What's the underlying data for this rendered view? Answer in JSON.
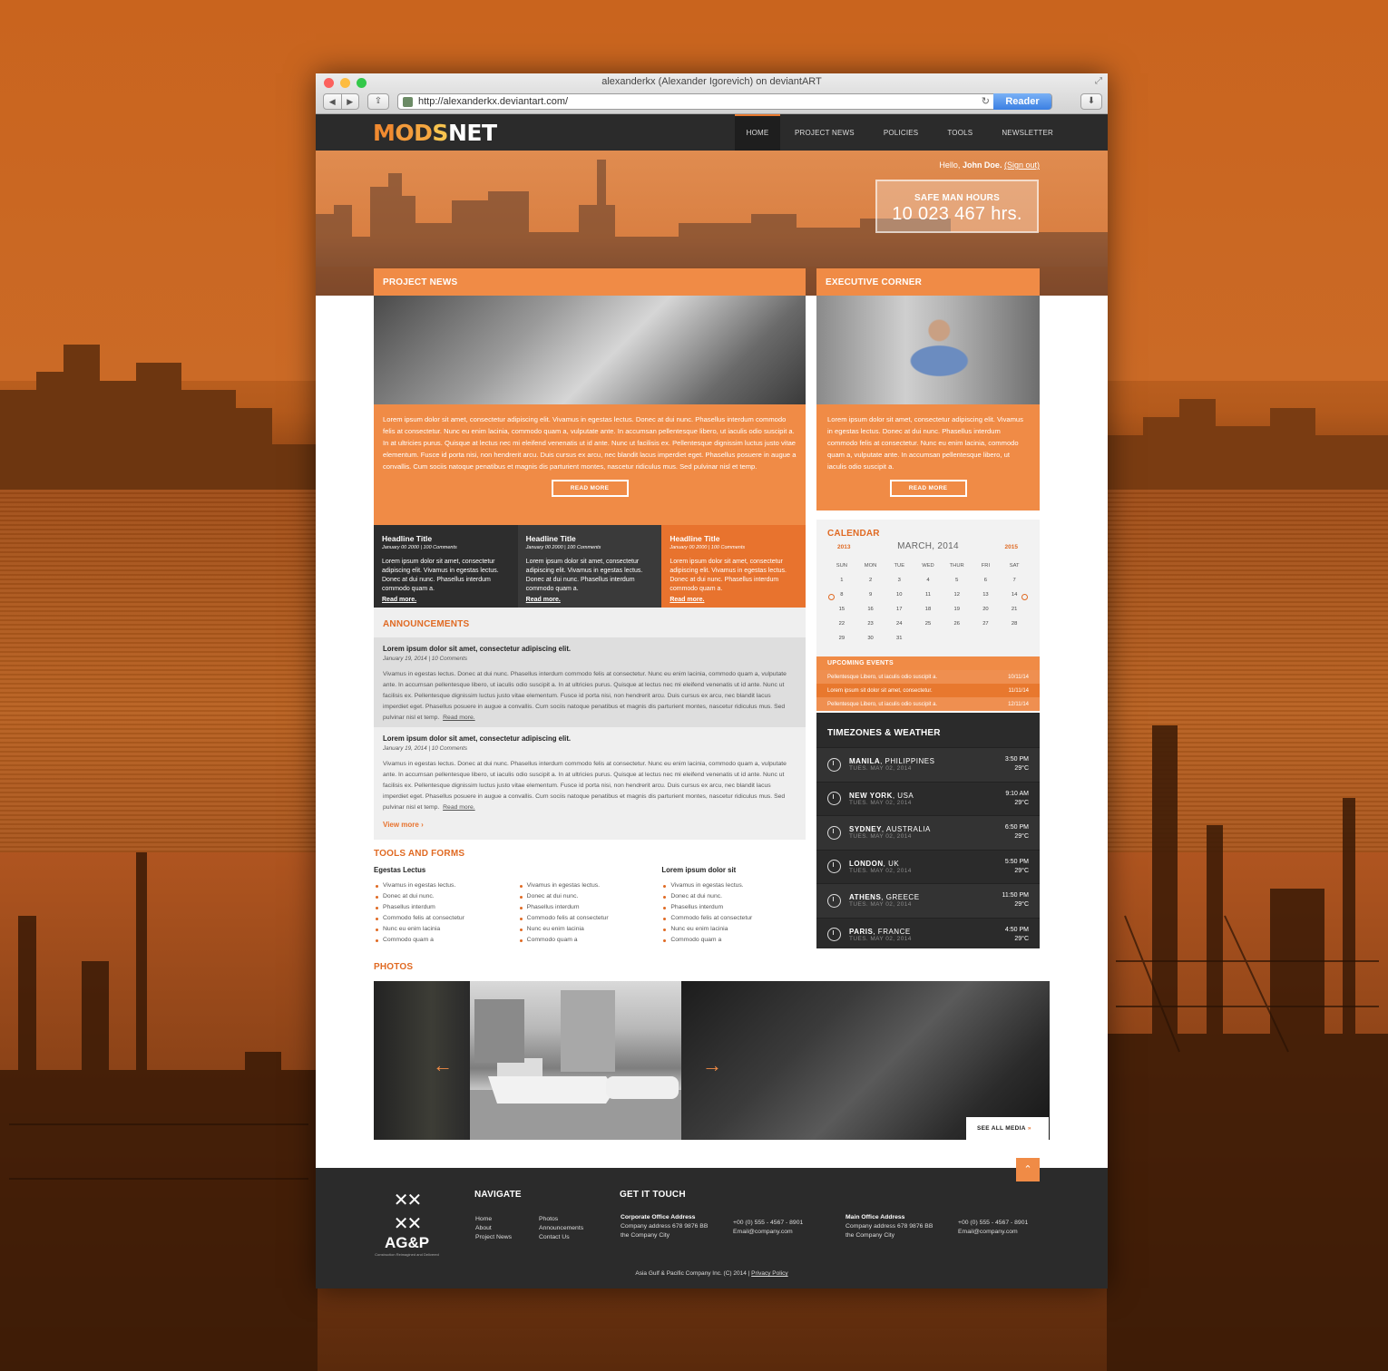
{
  "browser": {
    "title": "alexanderkx (Alexander Igorevich) on deviantART",
    "url": "http://alexanderkx.deviantart.com/",
    "reader": "Reader"
  },
  "site": {
    "logo": {
      "m": "M",
      "o": "O",
      "d": "D",
      "s": "S",
      "net": "NET"
    },
    "nav": [
      "HOME",
      "PROJECT NEWS",
      "POLICIES",
      "TOOLS",
      "NEWSLETTER"
    ],
    "hello": {
      "prefix": "Hello,",
      "name": "John Doe.",
      "signout": "(Sign out)"
    },
    "safe": {
      "label": "SAFE MAN HOURS",
      "value": "10 023 467 hrs."
    },
    "project_news": {
      "title": "PROJECT NEWS",
      "body": "Lorem ipsum dolor sit amet, consectetur adipiscing elit. Vivamus in egestas lectus. Donec at dui nunc. Phasellus interdum commodo felis at consectetur. Nunc eu enim lacinia, commodo quam a, vulputate ante. In accumsan pellentesque libero, ut iaculis odio suscipit a. In at ultricies purus. Quisque at lectus nec mi eleifend venenatis ut id ante. Nunc ut facilisis ex. Pellentesque dignissim luctus justo vitae elementum. Fusce id porta nisi, non hendrerit arcu. Duis cursus ex arcu, nec blandit lacus imperdiet eget. Phasellus posuere in augue a convallis. Cum sociis natoque penatibus et magnis dis parturient montes, nascetur ridiculus mus. Sed pulvinar nisl et temp.",
      "button": "READ MORE"
    },
    "headlines": [
      {
        "title": "Headline Title",
        "meta": "January 00 2000  |  100 Comments",
        "body": "Lorem ipsum dolor sit amet, consectetur adipiscing elit. Vivamus in egestas lectus. Donec at dui nunc. Phasellus interdum commodo quam a.",
        "link": "Read more.",
        "color": "#2d2d2d"
      },
      {
        "title": "Headline Title",
        "meta": "January 00 2000  |  100 Comments",
        "body": "Lorem ipsum dolor sit amet, consectetur adipiscing elit. Vivamus in egestas lectus. Donec at dui nunc. Phasellus interdum commodo quam a.",
        "link": "Read more.",
        "color": "#3a3a3a"
      },
      {
        "title": "Headline Title",
        "meta": "January 00 2000  |  100 Comments",
        "body": "Lorem ipsum dolor sit amet, consectetur adipiscing elit. Vivamus in egestas lectus. Donec at dui nunc. Phasellus interdum commodo quam a.",
        "link": "Read more.",
        "color": "#e8732e"
      }
    ],
    "announcements": {
      "title": "ANNOUNCEMENTS",
      "items": [
        {
          "title": "Lorem ipsum dolor sit amet, consectetur adipiscing elit.",
          "meta": "January 19, 2014   |   10 Comments",
          "body": "Vivamus in egestas lectus. Donec at dui nunc. Phasellus interdum commodo felis at consectetur. Nunc eu enim lacinia, commodo quam a, vulputate ante. In accumsan pellentesque libero, ut iaculis odio suscipit a. In at ultricies purus. Quisque at lectus nec mi eleifend venenatis ut id ante. Nunc ut facilisis ex. Pellentesque dignissim luctus justo vitae elementum. Fusce id porta nisi, non hendrerit arcu. Duis cursus ex arcu, nec blandit lacus imperdiet eget. Phasellus posuere in augue a convallis. Cum sociis natoque penatibus et magnis dis parturient montes, nascetur ridiculus mus. Sed pulvinar nisl et temp.",
          "link": "Read more."
        },
        {
          "title": "Lorem ipsum dolor sit amet, consectetur adipiscing elit.",
          "meta": "January 19, 2014   |   10 Comments",
          "body": "Vivamus in egestas lectus. Donec at dui nunc. Phasellus interdum commodo felis at consectetur. Nunc eu enim lacinia, commodo quam a, vulputate ante. In accumsan pellentesque libero, ut iaculis odio suscipit a. In at ultricies purus. Quisque at lectus nec mi eleifend venenatis ut id ante. Nunc ut facilisis ex. Pellentesque dignissim luctus justo vitae elementum. Fusce id porta nisi, non hendrerit arcu. Duis cursus ex arcu, nec blandit lacus imperdiet eget. Phasellus posuere in augue a convallis. Cum sociis natoque penatibus et magnis dis parturient montes, nascetur ridiculus mus. Sed pulvinar nisl et temp.",
          "link": "Read more."
        }
      ],
      "view_more": "View more"
    },
    "tools": {
      "title": "TOOLS AND FORMS",
      "columns": [
        {
          "heading": "Egestas Lectus",
          "items": [
            "Vivamus in egestas lectus.",
            "Donec at dui nunc.",
            "Phasellus interdum",
            "Commodo felis at consectetur",
            "Nunc eu enim lacinia",
            "Commodo quam a"
          ]
        },
        {
          "heading": "",
          "items": [
            "Vivamus in egestas lectus.",
            "Donec at dui nunc.",
            "Phasellus interdum",
            "Commodo felis at consectetur",
            "Nunc eu enim lacinia",
            "Commodo quam a"
          ]
        },
        {
          "heading": "Lorem ipsum dolor sit",
          "items": [
            "Vivamus in egestas lectus.",
            "Donec at dui nunc.",
            "Phasellus interdum",
            "Commodo felis at consectetur",
            "Nunc eu enim lacinia",
            "Commodo quam a"
          ]
        }
      ]
    },
    "executive": {
      "title": "EXECUTIVE CORNER",
      "body": "Lorem ipsum dolor sit amet, consectetur adipiscing elit. Vivamus in egestas lectus. Donec at dui nunc. Phasellus interdum commodo felis at consectetur. Nunc eu enim lacinia, commodo quam a, vulputate ante. In accumsan pellentesque libero, ut iaculis odio suscipit a.",
      "button": "READ MORE"
    },
    "calendar": {
      "title": "CALENDAR",
      "prev_year": "2013",
      "month": "MARCH, 2014",
      "next_year": "2015",
      "days": [
        "SUN",
        "MON",
        "TUE",
        "WED",
        "THUR",
        "FRI",
        "SAT"
      ],
      "dates": [
        "1",
        "2",
        "3",
        "4",
        "5",
        "6",
        "7",
        "8",
        "9",
        "10",
        "11",
        "12",
        "13",
        "14",
        "15",
        "16",
        "17",
        "18",
        "19",
        "20",
        "21",
        "22",
        "23",
        "24",
        "25",
        "26",
        "27",
        "28",
        "29",
        "30",
        "31"
      ]
    },
    "events": {
      "title": "UPCOMING EVENTS",
      "items": [
        {
          "text": "Pellentesque Libero, ut iaculis odio suscipit a.",
          "date": "10/11/14"
        },
        {
          "text": "Lorem ipsum sit dolor sit amet, consectetur.",
          "date": "11/11/14"
        },
        {
          "text": "Pellentesque Libero, ut iaculis odio suscipit a.",
          "date": "12/11/14"
        }
      ]
    },
    "timezones": {
      "title": "TIMEZONES & WEATHER",
      "items": [
        {
          "city": "MANILA",
          "country": ", PHILIPPINES",
          "date": "TUES. MAY 02, 2014",
          "time": "3:50 PM",
          "temp": "29°C"
        },
        {
          "city": "NEW YORK",
          "country": ", USA",
          "date": "TUES. MAY 02, 2014",
          "time": "9:10 AM",
          "temp": "29°C"
        },
        {
          "city": "SYDNEY",
          "country": ", AUSTRALIA",
          "date": "TUES. MAY 02, 2014",
          "time": "6:50 PM",
          "temp": "29°C"
        },
        {
          "city": "LONDON",
          "country": ", UK",
          "date": "TUES. MAY 02, 2014",
          "time": "5:50 PM",
          "temp": "29°C"
        },
        {
          "city": "ATHENS",
          "country": ", GREECE",
          "date": "TUES. MAY 02, 2014",
          "time": "11:50 PM",
          "temp": "29°C"
        },
        {
          "city": "PARIS",
          "country": ", FRANCE",
          "date": "TUES. MAY 02, 2014",
          "time": "4:50 PM",
          "temp": "29°C"
        }
      ]
    },
    "photos": {
      "title": "PHOTOS",
      "see_all": "SEE ALL MEDIA"
    },
    "footer": {
      "brand": "AG&P",
      "tagline": "Construction Reimagined and Delivered",
      "navigate": {
        "title": "NAVIGATE",
        "col1": [
          "Home",
          "About",
          "Project News"
        ],
        "col2": [
          "Photos",
          "Announcements",
          "Contact Us"
        ]
      },
      "contact": {
        "title": "GET IT TOUCH",
        "corp": {
          "heading": "Corporate Office Address",
          "l1": "Company address 678 9876 BB",
          "l2": "the Company City",
          "phone": "+00 (0) 555 - 4567 - 8901",
          "email": "Email@company.com"
        },
        "main": {
          "heading": "Main Office Address",
          "l1": "Company address 678 9876 BB",
          "l2": "the Company City",
          "phone": "+00 (0) 555 - 4567 - 8901",
          "email": "Email@company.com"
        }
      },
      "copyright": "Asia Gulf & Pacific Company Inc. (C) 2014 |",
      "privacy": "Privacy Policy"
    }
  }
}
